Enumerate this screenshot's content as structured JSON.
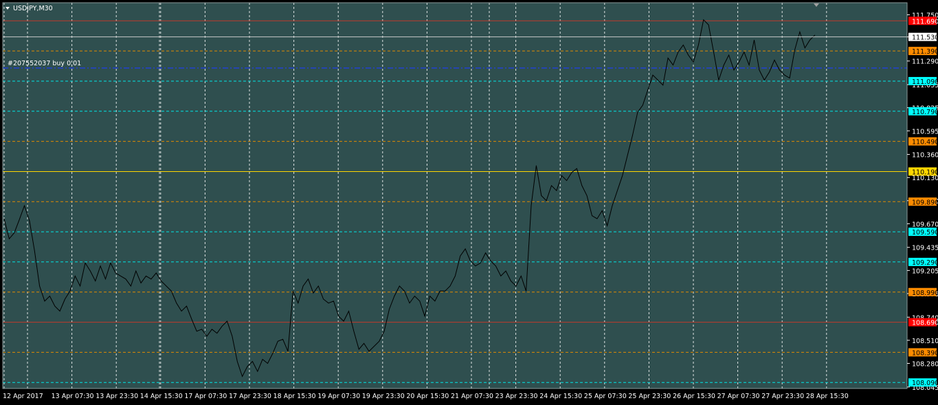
{
  "window": {
    "title": "USDJPY,M30"
  },
  "trade": {
    "label": "#207552037 buy 0.01",
    "price": 111.22,
    "color": "#1e3cff"
  },
  "colors": {
    "background": "#2f4f4f",
    "grid": "#ffffff",
    "price_line": "#000000",
    "axis_bg": "#000000",
    "axis_text": "#ffffff"
  },
  "chart_data": {
    "type": "line",
    "symbol": "USDJPY",
    "timeframe": "M30",
    "title": "USDJPY,M30",
    "ylim": [
      108.03,
      111.87
    ],
    "grid": true,
    "y_ticks": [
      "111.750",
      "111.530",
      "111.290",
      "111.055",
      "110.825",
      "110.595",
      "110.360",
      "110.130",
      "109.900",
      "109.670",
      "109.435",
      "109.205",
      "108.975",
      "108.740",
      "108.510",
      "108.280",
      "108.045"
    ],
    "x_ticks": [
      "12 Apr 2017",
      "13 Apr 07:30",
      "13 Apr 23:30",
      "14 Apr 15:30",
      "17 Apr 07:30",
      "17 Apr 23:30",
      "18 Apr 15:30",
      "19 Apr 07:30",
      "19 Apr 23:30",
      "20 Apr 15:30",
      "21 Apr 07:30",
      "23 Apr 23:30",
      "24 Apr 15:30",
      "25 Apr 07:30",
      "25 Apr 23:30",
      "26 Apr 15:30",
      "27 Apr 07:30",
      "27 Apr 23:30",
      "28 Apr 15:30"
    ],
    "current_price": "111.530",
    "levels": [
      {
        "label": "111.690",
        "price": 111.69,
        "style": "solid",
        "line_color": "#c0392b",
        "badge_bg": "#ff0000",
        "badge_fg": "#ffffff"
      },
      {
        "label": "111.390",
        "price": 111.39,
        "style": "dashed",
        "line_color": "#e08a00",
        "badge_bg": "#ff8c00",
        "badge_fg": "#000000"
      },
      {
        "label": "111.090",
        "price": 111.09,
        "style": "dashed",
        "line_color": "#00e5e5",
        "badge_bg": "#00ffff",
        "badge_fg": "#000000"
      },
      {
        "label": "110.790",
        "price": 110.79,
        "style": "dashed",
        "line_color": "#00e5e5",
        "badge_bg": "#00ffff",
        "badge_fg": "#000000"
      },
      {
        "label": "110.490",
        "price": 110.49,
        "style": "dashed",
        "line_color": "#e08a00",
        "badge_bg": "#ff8c00",
        "badge_fg": "#000000"
      },
      {
        "label": "110.190",
        "price": 110.19,
        "style": "solid",
        "line_color": "#ffd700",
        "badge_bg": "#ffd700",
        "badge_fg": "#000000"
      },
      {
        "label": "109.890",
        "price": 109.89,
        "style": "dashed",
        "line_color": "#e08a00",
        "badge_bg": "#ff8c00",
        "badge_fg": "#000000"
      },
      {
        "label": "109.590",
        "price": 109.59,
        "style": "dashed",
        "line_color": "#00e5e5",
        "badge_bg": "#00ffff",
        "badge_fg": "#000000"
      },
      {
        "label": "109.290",
        "price": 109.29,
        "style": "dashed",
        "line_color": "#00e5e5",
        "badge_bg": "#00ffff",
        "badge_fg": "#000000"
      },
      {
        "label": "108.990",
        "price": 108.99,
        "style": "dashed",
        "line_color": "#e08a00",
        "badge_bg": "#ff8c00",
        "badge_fg": "#000000"
      },
      {
        "label": "108.690",
        "price": 108.69,
        "style": "solid",
        "line_color": "#c0392b",
        "badge_bg": "#ff0000",
        "badge_fg": "#ffffff"
      },
      {
        "label": "108.390",
        "price": 108.39,
        "style": "dashed",
        "line_color": "#e08a00",
        "badge_bg": "#ff8c00",
        "badge_fg": "#000000"
      },
      {
        "label": "108.090",
        "price": 108.09,
        "style": "dashed",
        "line_color": "#00e5e5",
        "badge_bg": "#00ffff",
        "badge_fg": "#000000"
      }
    ],
    "series": [
      {
        "values": [
          109.72,
          109.52,
          109.58,
          109.71,
          109.85,
          109.7,
          109.4,
          109.05,
          108.9,
          108.95,
          108.85,
          108.8,
          108.92,
          109.0,
          109.15,
          109.05,
          109.28,
          109.2,
          109.1,
          109.25,
          109.12,
          109.28,
          109.18,
          109.15,
          109.12,
          109.05,
          109.2,
          109.08,
          109.15,
          109.12,
          109.18,
          109.1,
          109.05,
          109.0,
          108.88,
          108.8,
          108.85,
          108.72,
          108.6,
          108.62,
          108.55,
          108.62,
          108.58,
          108.65,
          108.7,
          108.55,
          108.3,
          108.15,
          108.25,
          108.3,
          108.2,
          108.32,
          108.28,
          108.38,
          108.5,
          108.52,
          108.4,
          109.0,
          108.88,
          109.05,
          109.12,
          108.98,
          109.05,
          108.92,
          108.88,
          108.9,
          108.75,
          108.7,
          108.8,
          108.6,
          108.42,
          108.48,
          108.4,
          108.45,
          108.5,
          108.6,
          108.82,
          108.95,
          109.05,
          109.0,
          108.88,
          108.95,
          108.9,
          108.75,
          108.95,
          108.9,
          109.0,
          109.0,
          109.05,
          109.15,
          109.35,
          109.42,
          109.3,
          109.25,
          109.28,
          109.38,
          109.3,
          109.25,
          109.15,
          109.2,
          109.1,
          109.05,
          109.15,
          109.0,
          109.85,
          110.25,
          109.95,
          109.9,
          110.05,
          110.0,
          110.15,
          110.1,
          110.18,
          110.22,
          110.05,
          109.95,
          109.75,
          109.72,
          109.8,
          109.65,
          109.85,
          110.0,
          110.15,
          110.35,
          110.55,
          110.78,
          110.85,
          111.0,
          111.15,
          111.1,
          111.05,
          111.32,
          111.25,
          111.38,
          111.45,
          111.35,
          111.28,
          111.45,
          111.7,
          111.65,
          111.38,
          111.1,
          111.25,
          111.35,
          111.2,
          111.28,
          111.38,
          111.25,
          111.5,
          111.2,
          111.1,
          111.18,
          111.3,
          111.2,
          111.15,
          111.12,
          111.4,
          111.58,
          111.42,
          111.5,
          111.55
        ]
      }
    ]
  }
}
